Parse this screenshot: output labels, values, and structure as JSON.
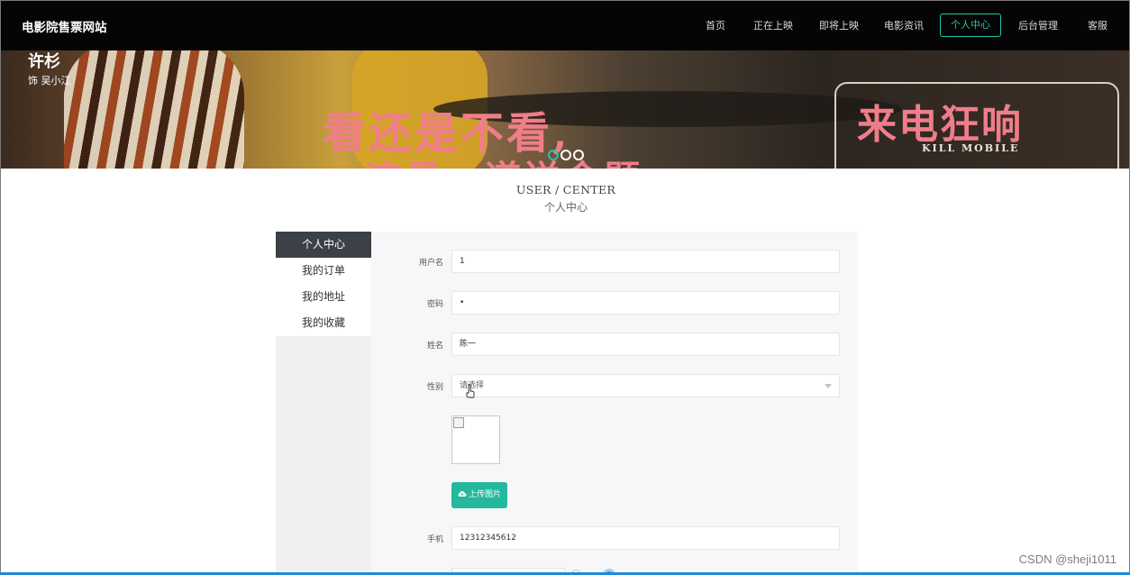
{
  "header": {
    "brand": "电影院售票网站",
    "nav": [
      {
        "label": "首页",
        "active": false
      },
      {
        "label": "正在上映",
        "active": false
      },
      {
        "label": "即将上映",
        "active": false
      },
      {
        "label": "电影资讯",
        "active": false
      },
      {
        "label": "个人中心",
        "active": true
      },
      {
        "label": "后台管理",
        "active": false
      },
      {
        "label": "客服",
        "active": false
      }
    ]
  },
  "banner": {
    "slogan_line1": "看还是不看,",
    "slogan_line2": "这是一道送命题",
    "actor_name": "许杉",
    "actor_role": "饰 吴小江",
    "poster_title": "来电狂响",
    "poster_subtitle": "KILL MOBILE",
    "slide_count": 3,
    "active_slide": 1,
    "accent_color": "#24c3a7"
  },
  "section": {
    "title_en": "USER / CENTER",
    "title_cn": "个人中心"
  },
  "sidebar": {
    "items": [
      {
        "label": "个人中心",
        "active": true
      },
      {
        "label": "我的订单",
        "active": false
      },
      {
        "label": "我的地址",
        "active": false
      },
      {
        "label": "我的收藏",
        "active": false
      }
    ]
  },
  "form": {
    "username": {
      "label": "用户名",
      "value": "1"
    },
    "password": {
      "label": "密码",
      "value": "•"
    },
    "name": {
      "label": "姓名",
      "value": "陈一"
    },
    "gender": {
      "label": "性别",
      "placeholder": "请选择"
    },
    "upload_label": "上传图片",
    "phone": {
      "label": "手机",
      "value": "12312345612"
    }
  },
  "watermark": "CSDN @sheji1011"
}
